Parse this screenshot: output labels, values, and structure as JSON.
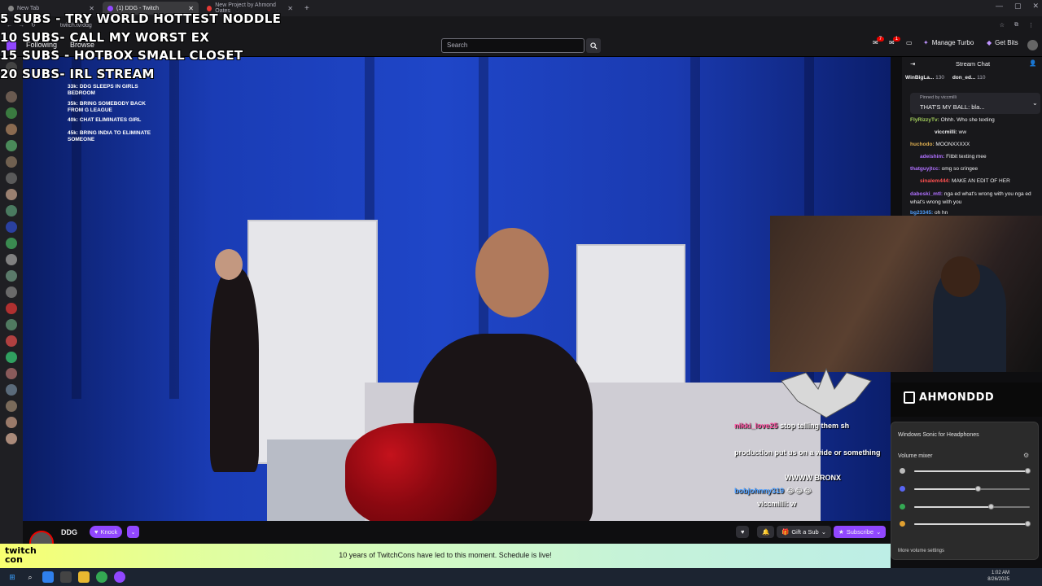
{
  "browser": {
    "tabs": [
      {
        "label": "New Tab",
        "color": "#888888"
      },
      {
        "label": "(1) DDG - Twitch",
        "color": "#9147ff"
      },
      {
        "label": "New Project by Ahmond Oates",
        "color": "#e53935"
      }
    ],
    "new_tab": "+",
    "url": "twitch.tv/ddg"
  },
  "nav": {
    "following": "Following",
    "browse": "Browse",
    "search_placeholder": "Search",
    "notif_count": "7",
    "inbox_count": "1",
    "manage_turbo": "Manage Turbo",
    "get_bits": "Get Bits"
  },
  "overlay": {
    "goals": [
      "5 SUBS - TRY WORLD HOTTEST NODDLE",
      "10 SUBS- CALL MY WORST EX",
      "15 SUBS - HOTBOX SMALL CLOSET",
      "20 SUBS- IRL STREAM"
    ],
    "small_goals": [
      "33k: DDG SLEEPS IN GIRLS BEDROOM",
      "35k: BRING SOMEBODY BACK FROM G LEAGUE",
      "40k: CHAT ELIMINATES GIRL",
      "45k: BRING INDIA TO ELIMINATE SOMEONE"
    ],
    "stream_chat": [
      {
        "user": "nikki_love25",
        "text": "stop telling them sh",
        "color": "#ff4fa0"
      },
      {
        "user": "",
        "text": "production put us on a wide or something",
        "color": "#9be36b"
      },
      {
        "user": "",
        "text": "WWWW BRONX",
        "color": "#ff4fa0"
      },
      {
        "user": "bobjohnny319",
        "text": "😂😂😂",
        "color": "#4fa0ff"
      },
      {
        "user": "viccmilli",
        "text": "w",
        "color": "#ffffff"
      }
    ],
    "logo_text": "AHMONDDD"
  },
  "channel": {
    "name": "DDG",
    "knock_label": "Knock",
    "gift_label": "Gift a Sub",
    "subscribe_label": "Subscribe"
  },
  "banner": {
    "logo_line1": "twitch",
    "logo_line2": "con",
    "text": "10 years of TwitchCons have led to this moment. Schedule is live!"
  },
  "chat": {
    "title": "Stream Chat",
    "leaders": [
      {
        "user": "WinBigLa...",
        "count": "130"
      },
      {
        "user": "don_ed...",
        "count": "110"
      }
    ],
    "pinned_by": "Pinned by",
    "pinned_user": "viccmilli",
    "pinned_text": "THAT'S MY BALL: bla...",
    "messages": [
      {
        "user": "FlyRizzyTv:",
        "text": "Ohhh. Who she texting",
        "color": "#a4d05d"
      },
      {
        "user": "viccmilli:",
        "text": "ww",
        "color": "#efeff1"
      },
      {
        "user": "huchodo:",
        "text": "MOONXXXXX",
        "color": "#e0b050"
      },
      {
        "user": "adeishim:",
        "text": "Fitbit texting mee",
        "color": "#b070ff"
      },
      {
        "user": "thatguyjtcc:",
        "text": "omg so cringee",
        "color": "#b070ff"
      },
      {
        "user": "sinalem444:",
        "text": "MAKE AN EDIT OF HER",
        "color": "#ff5050"
      },
      {
        "user": "daboski_mtl:",
        "text": "nga ed what's wrong with you nga ed what's wrong with you",
        "color": "#b070ff"
      },
      {
        "user": "bg23345:",
        "text": "oh hn",
        "color": "#50a0ff"
      }
    ]
  },
  "mixer": {
    "device": "Windows Sonic for Headphones",
    "title": "Volume mixer",
    "sliders": [
      {
        "app": "system",
        "value": 98,
        "color": "#bbbbbb"
      },
      {
        "app": "discord",
        "value": 55,
        "color": "#5865f2"
      },
      {
        "app": "chrome",
        "value": 66,
        "color": "#34a853"
      },
      {
        "app": "other",
        "value": 98,
        "color": "#e0a030"
      }
    ],
    "more": "More volume settings"
  },
  "taskbar": {
    "time": "1:02 AM",
    "date": "8/26/2025"
  }
}
